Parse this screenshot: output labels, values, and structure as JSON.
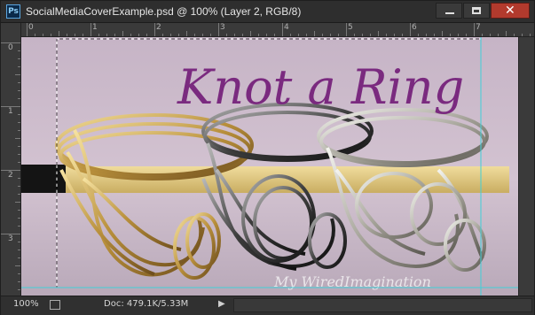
{
  "window": {
    "app_icon": "Ps",
    "title": "SocialMediaCoverExample.psd @ 100% (Layer 2, RGB/8)",
    "buttons": {
      "minimize_icon": "minimize-icon",
      "maximize_icon": "maximize-icon",
      "close_icon": "close-icon"
    }
  },
  "rulers": {
    "horizontal": [
      "0",
      "1",
      "2",
      "3",
      "4",
      "5",
      "6",
      "7"
    ],
    "vertical": [
      "0",
      "1",
      "2",
      "3"
    ]
  },
  "canvas": {
    "image_title": "Knot a Ring",
    "watermark": "My WiredImagination"
  },
  "status": {
    "zoom": "100%",
    "doc_info": "Doc: 479.1K/5.33M",
    "arrow": "▶"
  },
  "colors": {
    "title_text": "#7a2a7f",
    "guide": "#40d0d8",
    "close": "#b23a2d"
  }
}
